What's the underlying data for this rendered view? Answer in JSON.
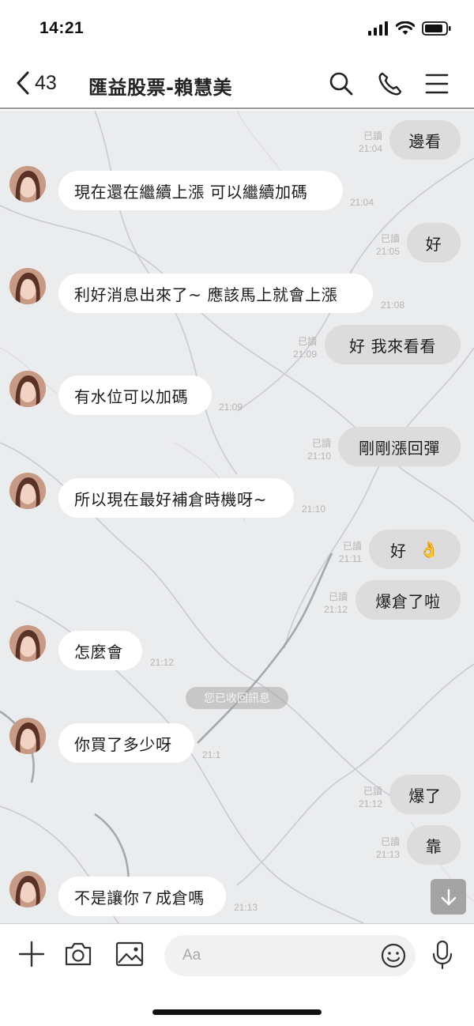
{
  "status_bar": {
    "time": "14:21"
  },
  "header": {
    "back_count": "43",
    "title": "匯益股票-賴慧美"
  },
  "messages": [
    {
      "dir": "out",
      "text": "邊看",
      "read": "已讀",
      "time": "21:04"
    },
    {
      "dir": "in",
      "text": "現在還在繼續上漲  可以繼續加碼",
      "time": "21:04"
    },
    {
      "dir": "out",
      "text": "好",
      "read": "已讀",
      "time": "21:05"
    },
    {
      "dir": "in",
      "text": "利好消息出來了~  應該馬上就會上漲",
      "time": "21:08"
    },
    {
      "dir": "out",
      "text": "好  我來看看",
      "read": "已讀",
      "time": "21:09"
    },
    {
      "dir": "in",
      "text": "有水位可以加碼",
      "time": "21:09"
    },
    {
      "dir": "out",
      "text": "剛剛漲回彈",
      "read": "已讀",
      "time": "21:10"
    },
    {
      "dir": "in",
      "text": "所以現在最好補倉時機呀~",
      "time": "21:10"
    },
    {
      "dir": "out",
      "text": "好",
      "emoji": "👌",
      "read": "已讀",
      "time": "21:11"
    },
    {
      "dir": "out",
      "text": "爆倉了啦",
      "read": "已讀",
      "time": "21:12"
    },
    {
      "dir": "in",
      "text": "怎麼會",
      "time": "21:12"
    },
    {
      "dir": "in",
      "text": "你買了多少呀",
      "time": "21:1"
    },
    {
      "dir": "out",
      "text": "爆了",
      "read": "已讀",
      "time": "21:12"
    },
    {
      "dir": "out",
      "text": "靠",
      "read": "已讀",
      "time": "21:13"
    },
    {
      "dir": "in",
      "text": "不是讓你７成倉嗎",
      "time": "21:13"
    }
  ],
  "system_notice": "您已收回訊息",
  "input": {
    "placeholder": "Aa"
  },
  "colors": {
    "incoming_bubble": "#ffffff",
    "outgoing_bubble": "#dcdcdc",
    "chat_background": "#e9eaec",
    "meta_text": "#b5b5b5"
  },
  "icons": {
    "back": "chevron-left-icon",
    "search": "search-icon",
    "call": "phone-icon",
    "menu": "menu-icon",
    "add": "plus-icon",
    "camera": "camera-icon",
    "image": "image-icon",
    "emoji": "emoji-icon",
    "mic": "microphone-icon",
    "scroll": "arrow-down-icon"
  }
}
